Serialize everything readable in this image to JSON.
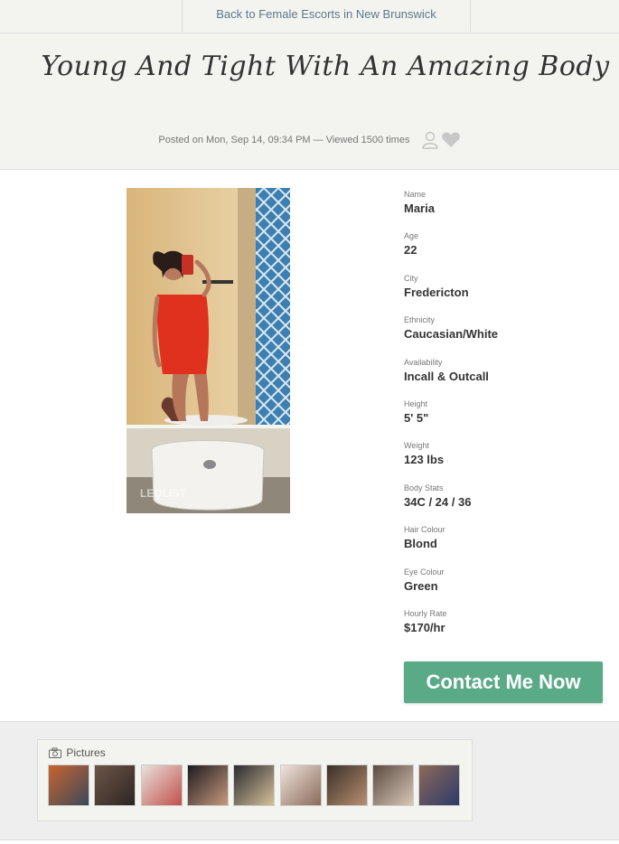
{
  "nav": {
    "back_label": "Back to Female Escorts in New Brunswick"
  },
  "listing": {
    "title": "Young And Tight With An Amazing Body",
    "posted": "Posted on Mon, Sep 14, 09:34 PM — Viewed 1500 times"
  },
  "profile": {
    "fields": [
      {
        "label": "Name",
        "value": "Maria"
      },
      {
        "label": "Age",
        "value": "22"
      },
      {
        "label": "City",
        "value": "Fredericton"
      },
      {
        "label": "Ethnicity",
        "value": "Caucasian/White"
      },
      {
        "label": "Availability",
        "value": "Incall & Outcall"
      },
      {
        "label": "Height",
        "value": "5' 5\""
      },
      {
        "label": "Weight",
        "value": "123 lbs"
      },
      {
        "label": "Body Stats",
        "value": "34C / 24 / 36"
      },
      {
        "label": "Hair Colour",
        "value": "Blond"
      },
      {
        "label": "Eye Colour",
        "value": "Green"
      },
      {
        "label": "Hourly Rate",
        "value": "$170/hr"
      }
    ]
  },
  "contact": {
    "label": "Contact Me Now"
  },
  "gallery": {
    "heading": "Pictures",
    "count": 9
  },
  "photo_watermark": "LEOLIST",
  "colors": {
    "accent": "#5aaa88",
    "link": "#5b7a8c",
    "header_bg": "#f3f3ef"
  }
}
